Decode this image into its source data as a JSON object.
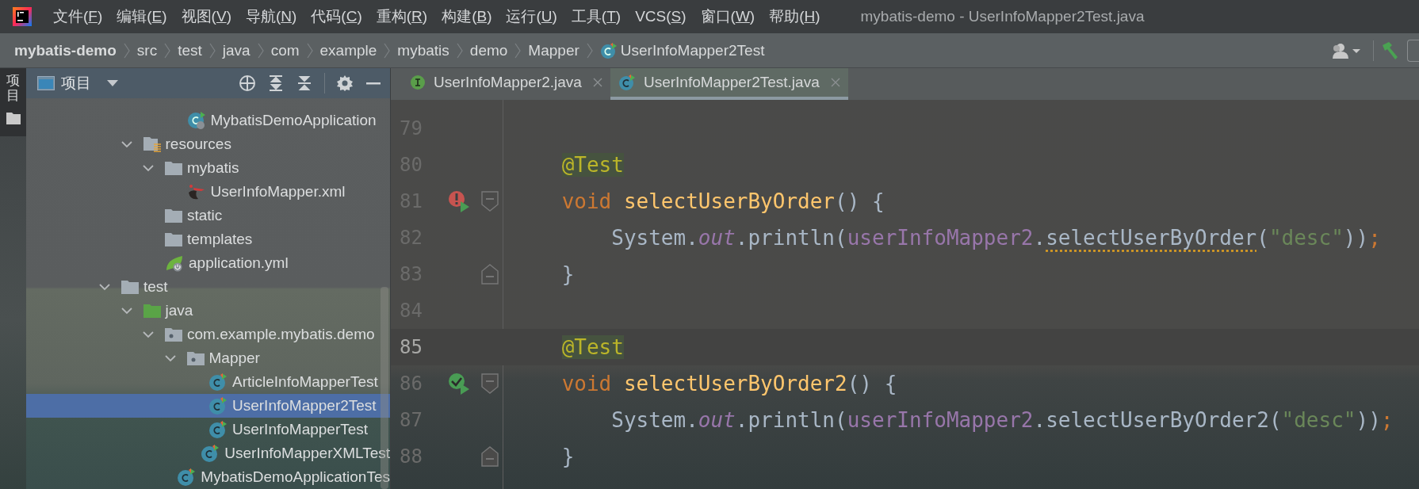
{
  "menu": {
    "items": [
      {
        "head": "文件(",
        "key": "F",
        "tail": ")"
      },
      {
        "head": "编辑(",
        "key": "E",
        "tail": ")"
      },
      {
        "head": "视图(",
        "key": "V",
        "tail": ")"
      },
      {
        "head": "导航(",
        "key": "N",
        "tail": ")"
      },
      {
        "head": "代码(",
        "key": "C",
        "tail": ")"
      },
      {
        "head": "重构(",
        "key": "R",
        "tail": ")"
      },
      {
        "head": "构建(",
        "key": "B",
        "tail": ")"
      },
      {
        "head": "运行(",
        "key": "U",
        "tail": ")"
      },
      {
        "head": "工具(",
        "key": "T",
        "tail": ")"
      },
      {
        "head": "VCS(",
        "key": "S",
        "tail": ")"
      },
      {
        "head": "窗口(",
        "key": "W",
        "tail": ")"
      },
      {
        "head": "帮助(",
        "key": "H",
        "tail": ")"
      }
    ]
  },
  "window": {
    "title": "mybatis-demo - UserInfoMapper2Test.java"
  },
  "breadcrumb": [
    {
      "label": "mybatis-demo",
      "kind": "project"
    },
    {
      "label": "src",
      "kind": "folder"
    },
    {
      "label": "test",
      "kind": "folder"
    },
    {
      "label": "java",
      "kind": "folder"
    },
    {
      "label": "com",
      "kind": "folder"
    },
    {
      "label": "example",
      "kind": "folder"
    },
    {
      "label": "mybatis",
      "kind": "folder"
    },
    {
      "label": "demo",
      "kind": "folder"
    },
    {
      "label": "Mapper",
      "kind": "folder"
    },
    {
      "label": "UserInfoMapper2Test",
      "kind": "class"
    }
  ],
  "side_strip": {
    "label": "项目"
  },
  "project_panel": {
    "title": "项目",
    "tree": [
      {
        "children": [
          {
            "children": [
              {
                "children": [
                  {
                    "label": "MybatisDemoApplication",
                    "kind": "spring-class",
                    "selected": false
                  }
                ]
              }
            ]
          },
          {
            "label": "resources",
            "kind": "resources-folder",
            "expanded": true,
            "selected": false,
            "children": [
              {
                "label": "mybatis",
                "kind": "folder",
                "expanded": true,
                "selected": false,
                "children": [
                  {
                    "label": "UserInfoMapper.xml",
                    "kind": "mybatis-xml",
                    "selected": false
                  }
                ]
              },
              {
                "label": "static",
                "kind": "folder",
                "selected": false
              },
              {
                "label": "templates",
                "kind": "folder",
                "selected": false
              },
              {
                "label": "application.yml",
                "kind": "spring-config",
                "selected": false
              }
            ]
          }
        ]
      },
      {
        "label": "test",
        "kind": "folder",
        "expanded": true,
        "selected": false,
        "children": [
          {
            "label": "java",
            "kind": "test-source",
            "expanded": true,
            "selected": false,
            "children": [
              {
                "label": "com.example.mybatis.demo",
                "kind": "package",
                "expanded": true,
                "selected": false,
                "children": [
                  {
                    "label": "Mapper",
                    "kind": "package",
                    "expanded": true,
                    "selected": false,
                    "children": [
                      {
                        "label": "ArticleInfoMapperTest",
                        "kind": "test-class",
                        "selected": false
                      },
                      {
                        "label": "UserInfoMapper2Test",
                        "kind": "test-class",
                        "selected": true
                      },
                      {
                        "label": "UserInfoMapperTest",
                        "kind": "test-class",
                        "selected": false
                      },
                      {
                        "label": "UserInfoMapperXMLTest",
                        "kind": "test-class",
                        "selected": false
                      }
                    ]
                  },
                  {
                    "label": "MybatisDemoApplicationTes",
                    "kind": "test-class",
                    "selected": false
                  }
                ]
              }
            ]
          }
        ]
      }
    ]
  },
  "editor": {
    "tabs": [
      {
        "label": "UserInfoMapper2.java",
        "kind": "interface",
        "selected": false
      },
      {
        "label": "UserInfoMapper2Test.java",
        "kind": "test-class",
        "selected": true
      }
    ],
    "lines": [
      {
        "number": "79",
        "current": false
      },
      {
        "number": "80",
        "current": false,
        "tokens": [
          {
            "kind": "annotation",
            "text": "    @Test"
          }
        ]
      },
      {
        "number": "81",
        "current": false,
        "gutter": [
          {
            "kind": "run-failed"
          },
          {
            "kind": "fold-start"
          }
        ],
        "tokens": [
          {
            "kind": "keyword",
            "text": "    void"
          },
          {
            "kind": "method-decl",
            "text": " selectUserByOrder"
          },
          {
            "kind": "plain",
            "text": "() {"
          }
        ]
      },
      {
        "number": "82",
        "current": false,
        "tokens": [
          {
            "kind": "plain",
            "text": "        System."
          },
          {
            "kind": "field",
            "text": "out"
          },
          {
            "kind": "plain",
            "text": ".println("
          },
          {
            "kind": "member",
            "text": "userInfoMapper2"
          },
          {
            "kind": "plain",
            "text": "."
          },
          {
            "kind": "call-warning",
            "text": "selectUserByOrder"
          },
          {
            "kind": "plain",
            "text": "("
          },
          {
            "kind": "string",
            "text": "\"desc\""
          },
          {
            "kind": "plain",
            "text": "))"
          },
          {
            "kind": "punct",
            "text": ";"
          }
        ]
      },
      {
        "number": "83",
        "current": false,
        "gutter": [
          {
            "kind": "fold-end"
          }
        ],
        "tokens": [
          {
            "kind": "plain",
            "text": "    }"
          }
        ]
      },
      {
        "number": "84",
        "current": false
      },
      {
        "number": "85",
        "current": true,
        "tokens": [
          {
            "kind": "annotation",
            "text": "    @Test"
          }
        ]
      },
      {
        "number": "86",
        "current": false,
        "gutter": [
          {
            "kind": "run-passed"
          },
          {
            "kind": "fold-start"
          }
        ],
        "tokens": [
          {
            "kind": "keyword",
            "text": "    void"
          },
          {
            "kind": "method-decl",
            "text": " selectUserByOrder2"
          },
          {
            "kind": "plain",
            "text": "() {"
          }
        ]
      },
      {
        "number": "87",
        "current": false,
        "tokens": [
          {
            "kind": "plain",
            "text": "        System."
          },
          {
            "kind": "field",
            "text": "out"
          },
          {
            "kind": "plain",
            "text": ".println("
          },
          {
            "kind": "member",
            "text": "userInfoMapper2"
          },
          {
            "kind": "plain",
            "text": ".selectUserByOrder2("
          },
          {
            "kind": "string",
            "text": "\"desc\""
          },
          {
            "kind": "plain",
            "text": "))"
          },
          {
            "kind": "punct",
            "text": ";"
          }
        ]
      },
      {
        "number": "88",
        "current": false,
        "gutter": [
          {
            "kind": "fold-end"
          }
        ],
        "tokens": [
          {
            "kind": "plain",
            "text": "    }"
          }
        ]
      }
    ]
  }
}
